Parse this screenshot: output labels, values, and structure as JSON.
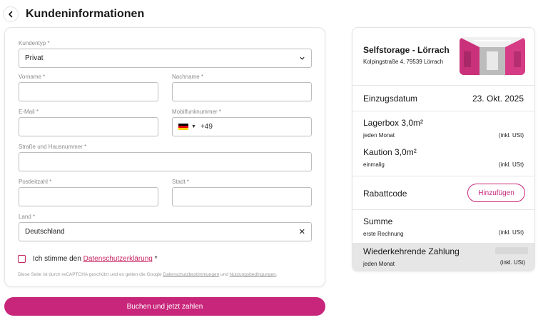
{
  "header": {
    "title": "Kundeninformationen"
  },
  "form": {
    "customer_type": {
      "label": "Kundentyp *",
      "value": "Privat"
    },
    "first_name": {
      "label": "Vorname *",
      "value": ""
    },
    "last_name": {
      "label": "Nachname *",
      "value": ""
    },
    "email": {
      "label": "E-Mail *",
      "value": ""
    },
    "mobile": {
      "label": "Mobilfunknummer *",
      "country_code": "+49",
      "value": ""
    },
    "street": {
      "label": "Straße und Hausnummer *",
      "value": ""
    },
    "postal": {
      "label": "Postleitzahl *",
      "value": ""
    },
    "city": {
      "label": "Stadt *",
      "value": ""
    },
    "country": {
      "label": "Land *",
      "value": "Deutschland"
    },
    "consent": {
      "prefix": "Ich stimme den ",
      "link": "Datenschutzerklärung",
      "suffix": " *"
    },
    "recaptcha": {
      "prefix": "Diese Seite ist durch reCAPTCHA geschützt und es gelten die Google ",
      "privacy_link": "Datenschutzbestimmungen",
      "middle": " und ",
      "terms_link": "Nutzungsbedingungen",
      "suffix": "."
    }
  },
  "submit_button": {
    "label": "Buchen und jetzt zahlen"
  },
  "summary": {
    "location_name": "Selfstorage - Lörrach",
    "address": "Kolpingstraße 4, 79539 Lörrach",
    "move_in_label": "Einzugsdatum",
    "move_in_date": "23. Okt. 2025",
    "items": [
      {
        "name": "Lagerbox 3,0m²",
        "frequency": "jeden Monat",
        "tax_note": "(inkl. USt)"
      },
      {
        "name": "Kaution 3,0m²",
        "frequency": "einmalig",
        "tax_note": "(inkl. USt)"
      }
    ],
    "discount_label": "Rabattcode",
    "discount_button": "Hinzufügen",
    "total_label": "Summe",
    "total_sub": "erste Rechnung",
    "total_tax_note": "(inkl. USt)",
    "recurring_label": "Wiederkehrende Zahlung",
    "recurring_sub": "jeden Monat",
    "recurring_tax_note": "(inkl. USt)"
  },
  "colors": {
    "brand": "#c8267a",
    "border": "#bdbdbd"
  },
  "icons": [
    "back-arrow-icon",
    "chevron-down-icon",
    "germany-flag-icon",
    "clear-icon"
  ]
}
